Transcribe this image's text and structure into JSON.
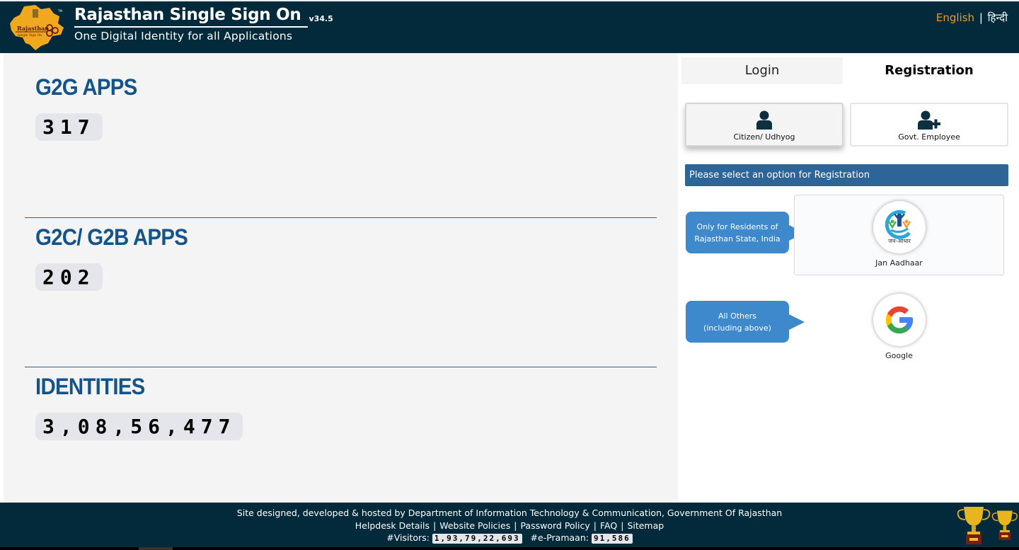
{
  "header": {
    "title": "Rajasthan Single Sign On",
    "version": "v34.5",
    "subtitle": "One Digital Identity for all Applications",
    "logo_text_top": "Rajasthan",
    "logo_text_bottom": "Single Sign On",
    "lang_english": "English",
    "lang_separator": "|",
    "lang_hindi": "हिन्दी"
  },
  "stats": [
    {
      "title": "G2G APPS",
      "value": "317"
    },
    {
      "title": "G2C/ G2B APPS",
      "value": "202"
    },
    {
      "title": "IDENTITIES",
      "value": "3,08,56,477"
    }
  ],
  "tabs": {
    "login": "Login",
    "registration": "Registration",
    "active": "Registration"
  },
  "registration": {
    "options": [
      {
        "label": "Citizen/ Udhyog",
        "icon": "user-icon",
        "selected": true
      },
      {
        "label": "Govt. Employee",
        "icon": "user-plus-icon",
        "selected": false
      }
    ],
    "banner": "Please select an option for Registration",
    "jan_aadhaar": {
      "bubble_line1": "Only for Residents of",
      "bubble_line2": "Rajasthan State, India",
      "logo_text": "जन-आधार",
      "label": "Jan Aadhaar"
    },
    "google": {
      "bubble_line1": "All Others",
      "bubble_line2": "(including above)",
      "label": "Google"
    }
  },
  "footer": {
    "credit": "Site designed, developed & hosted by Department of Information Technology & Communication, Government Of Rajasthan",
    "links": [
      "Helpdesk Details",
      "Website Policies",
      "Password Policy",
      "FAQ",
      "Sitemap"
    ],
    "visitors_label": "#Visitors:",
    "visitors_value": "1,93,79,22,693",
    "epramaan_label": "#e-Pramaan:",
    "epramaan_value": "91,586"
  },
  "colors": {
    "header_bg": "#022a3a",
    "accent_blue": "#15548a",
    "banner_blue": "#2e6599",
    "bubble_blue": "#3d89cc",
    "lang_active": "#e59b26"
  }
}
